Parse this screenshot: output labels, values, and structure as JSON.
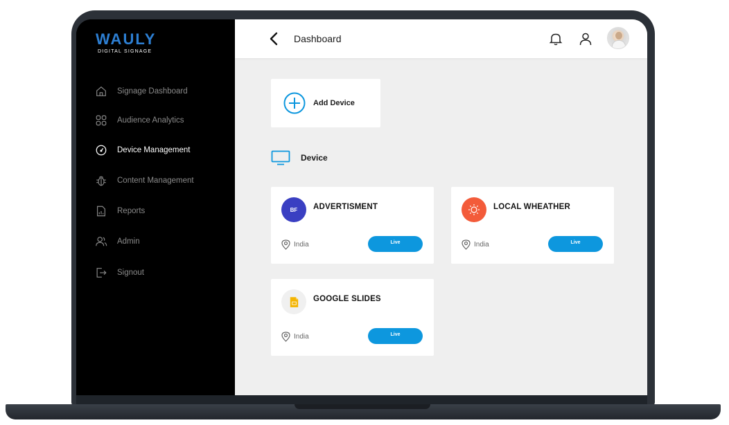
{
  "brand": {
    "name": "WAULY",
    "tagline": "DIGITAL SIGNAGE",
    "accent": "#2d7fd3"
  },
  "sidebar": {
    "items": [
      {
        "label": "Signage Dashboard",
        "icon": "home-icon",
        "active": false
      },
      {
        "label": "Audience Analytics",
        "icon": "grid-icon",
        "active": false
      },
      {
        "label": "Device Management",
        "icon": "gauge-icon",
        "active": true
      },
      {
        "label": "Content Management",
        "icon": "bug-icon",
        "active": false
      },
      {
        "label": "Reports",
        "icon": "report-icon",
        "active": false
      },
      {
        "label": "Admin",
        "icon": "users-icon",
        "active": false
      },
      {
        "label": "Signout",
        "icon": "signout-icon",
        "active": false
      }
    ]
  },
  "header": {
    "title": "Dashboard"
  },
  "actions": {
    "add_device_label": "Add Device"
  },
  "section": {
    "title": "Device"
  },
  "devices": [
    {
      "badge": "BF",
      "title": "ADVERTISMENT",
      "location": "India",
      "status": "Live",
      "icon_color": "#3a3fc2"
    },
    {
      "badge": "",
      "title": "LOCAL WHEATHER",
      "location": "India",
      "status": "Live",
      "icon_color": "#f35b3a"
    },
    {
      "badge": "",
      "title": "GOOGLE SLIDES",
      "location": "India",
      "status": "Live",
      "icon_color": "#f4b400"
    }
  ],
  "colors": {
    "live": "#0d97de",
    "sidebar_bg": "#000000",
    "main_bg": "#efefef"
  }
}
